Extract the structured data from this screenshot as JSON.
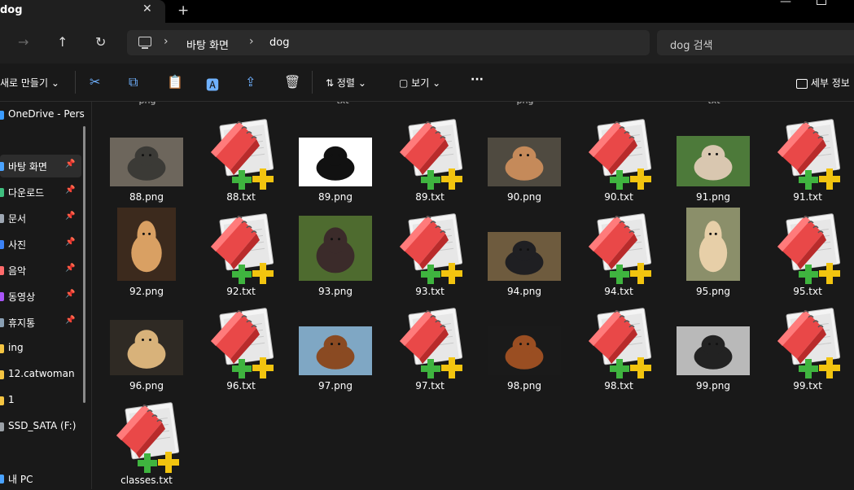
{
  "tab": {
    "title": "dog",
    "close": "✕",
    "new": "+"
  },
  "window": {
    "minimize": "—"
  },
  "nav": {
    "back": "←",
    "forward": "→",
    "up": "↑",
    "refresh": "↻"
  },
  "address": {
    "crumbs": [
      "바탕 화면",
      "dog"
    ],
    "sep": "›"
  },
  "search": {
    "placeholder": "dog 검색"
  },
  "commands": {
    "new": "새로 만들기",
    "sort": "정렬",
    "view": "보기",
    "more": "···",
    "details": "세부 정보",
    "icons": {
      "cut": "✂",
      "copy": "⧉",
      "paste": "📋",
      "rename": "🅰",
      "share": "⇪",
      "delete": "🗑",
      "sort": "⇅",
      "view": "▢",
      "dropdown": "⌄"
    }
  },
  "sidebar": {
    "items": [
      {
        "label": "OneDrive - Pers",
        "color": "#3b9cff",
        "pinned": false,
        "selected": false
      },
      {
        "label": "바탕 화면",
        "color": "#4aa3ff",
        "pinned": true,
        "selected": true
      },
      {
        "label": "다운로드",
        "color": "#3fbf7f",
        "pinned": true,
        "selected": false
      },
      {
        "label": "문서",
        "color": "#9ea7b3",
        "pinned": true,
        "selected": false
      },
      {
        "label": "사진",
        "color": "#3b82f6",
        "pinned": true,
        "selected": false
      },
      {
        "label": "음악",
        "color": "#ff6b6b",
        "pinned": true,
        "selected": false
      },
      {
        "label": "동영상",
        "color": "#a855f7",
        "pinned": true,
        "selected": false
      },
      {
        "label": "휴지통",
        "color": "#8aa0b4",
        "pinned": true,
        "selected": false
      },
      {
        "label": "ing",
        "color": "#f5c542",
        "pinned": false,
        "selected": false
      },
      {
        "label": "12.catwoman",
        "color": "#f5c542",
        "pinned": false,
        "selected": false
      },
      {
        "label": "1",
        "color": "#f5c542",
        "pinned": false,
        "selected": false
      },
      {
        "label": "SSD_SATA (F:)",
        "color": "#9aa0a6",
        "pinned": false,
        "selected": false
      },
      {
        "label": "내 PC",
        "color": "#4aa3ff",
        "pinned": false,
        "selected": false
      }
    ],
    "pin_icon": "📌"
  },
  "files": {
    "prev_row_labels": [
      "png",
      "txt",
      "png",
      "txt"
    ],
    "items": [
      {
        "name": "88.png",
        "kind": "png"
      },
      {
        "name": "88.txt",
        "kind": "txt"
      },
      {
        "name": "89.png",
        "kind": "png"
      },
      {
        "name": "89.txt",
        "kind": "txt"
      },
      {
        "name": "90.png",
        "kind": "png"
      },
      {
        "name": "90.txt",
        "kind": "txt"
      },
      {
        "name": "91.png",
        "kind": "png"
      },
      {
        "name": "91.txt",
        "kind": "txt"
      },
      {
        "name": "92.png",
        "kind": "png"
      },
      {
        "name": "92.txt",
        "kind": "txt"
      },
      {
        "name": "93.png",
        "kind": "png"
      },
      {
        "name": "93.txt",
        "kind": "txt"
      },
      {
        "name": "94.png",
        "kind": "png"
      },
      {
        "name": "94.txt",
        "kind": "txt"
      },
      {
        "name": "95.png",
        "kind": "png"
      },
      {
        "name": "95.txt",
        "kind": "txt"
      },
      {
        "name": "96.png",
        "kind": "png"
      },
      {
        "name": "96.txt",
        "kind": "txt"
      },
      {
        "name": "97.png",
        "kind": "png"
      },
      {
        "name": "97.txt",
        "kind": "txt"
      },
      {
        "name": "98.png",
        "kind": "png"
      },
      {
        "name": "98.txt",
        "kind": "txt"
      },
      {
        "name": "99.png",
        "kind": "png"
      },
      {
        "name": "99.txt",
        "kind": "txt"
      },
      {
        "name": "classes.txt",
        "kind": "txt"
      }
    ]
  },
  "thumb_colors": [
    [
      "#6d665c",
      "#3b3a36"
    ],
    [
      "#ffffff",
      "#111111"
    ],
    [
      "#4f4a40",
      "#c58a5a"
    ],
    [
      "#4d7a3a",
      "#d9c7b0"
    ],
    [
      "#3c2a1d",
      "#d9a063"
    ],
    [
      "#4e6b2f",
      "#3b2b2a"
    ],
    [
      "#6e5b3e",
      "#1f1f22"
    ],
    [
      "#8b8f6a",
      "#e7cfa8"
    ],
    [
      "#2f2a24",
      "#d8b27a"
    ],
    [
      "#7fa7c4",
      "#8a4a22"
    ],
    [
      "#1a1a1a",
      "#9a4e22"
    ],
    [
      "#b9b9b9",
      "#222222"
    ]
  ]
}
